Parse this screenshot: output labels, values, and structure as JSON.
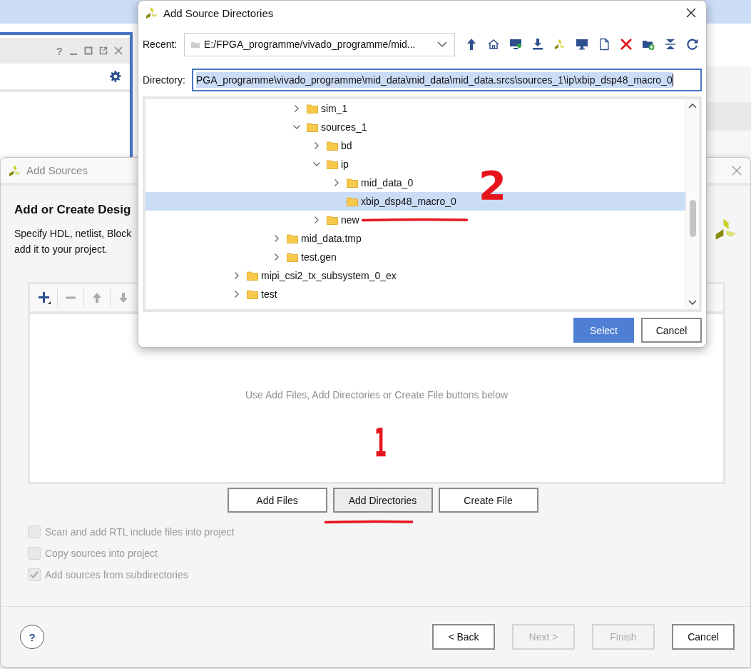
{
  "back_window": {
    "controls": [
      "?"
    ]
  },
  "add_sources": {
    "title": "Add Sources",
    "heading": "Add or Create Desig",
    "description": [
      "Specify HDL, netlist, Block",
      "add it to your project."
    ],
    "files_hint": "Use Add Files, Add Directories or Create File buttons below",
    "action_buttons": [
      {
        "label": "Add Files",
        "pressed": false
      },
      {
        "label": "Add Directories",
        "pressed": true
      },
      {
        "label": "Create File",
        "pressed": false
      }
    ],
    "options": [
      {
        "label": "Scan and add RTL include files into project",
        "checked": false,
        "disabled": true
      },
      {
        "label": "Copy sources into project",
        "checked": false,
        "disabled": true
      },
      {
        "label": "Add sources from subdirectories",
        "checked": true,
        "disabled": true
      }
    ],
    "help": "?",
    "nav_buttons": [
      {
        "label": "< Back",
        "disabled": false
      },
      {
        "label": "Next >",
        "disabled": true
      },
      {
        "label": "Finish",
        "disabled": true
      },
      {
        "label": "Cancel",
        "disabled": false
      }
    ]
  },
  "dialog": {
    "title": "Add Source Directories",
    "recent_label": "Recent:",
    "recent_value": "E:/FPGA_programme/vivado_programme/mid...",
    "directory_label": "Directory:",
    "directory_value": "PGA_programme\\vivado_programme\\mid_data\\mid_data\\mid_data.srcs\\sources_1\\ip\\xbip_dsp48_macro_0",
    "tree": [
      {
        "children": [
          {
            "children": [
              {
                "children": [
                  {
                    "label": "sim_1",
                    "expanded": false,
                    "selected": false
                  },
                  {
                    "label": "sources_1",
                    "expanded": true,
                    "selected": false,
                    "children": [
                      {
                        "label": "bd",
                        "expanded": false,
                        "selected": false
                      },
                      {
                        "label": "ip",
                        "expanded": true,
                        "selected": false,
                        "children": [
                          {
                            "label": "mid_data_0",
                            "expanded": false,
                            "selected": false
                          },
                          {
                            "label": "xbip_dsp48_macro_0",
                            "selected": true
                          }
                        ]
                      },
                      {
                        "label": "new",
                        "expanded": false,
                        "selected": false
                      }
                    ]
                  }
                ]
              },
              {
                "label": "mid_data.tmp",
                "expanded": false,
                "selected": false
              },
              {
                "label": "test.gen",
                "expanded": false,
                "selected": false
              }
            ]
          }
        ]
      },
      {
        "label": "mipi_csi2_tx_subsystem_0_ex",
        "expanded": false,
        "selected": false
      },
      {
        "label": "test",
        "expanded": false,
        "selected": false
      }
    ],
    "buttons": [
      {
        "label": "Select",
        "primary": true
      },
      {
        "label": "Cancel",
        "primary": false
      }
    ]
  },
  "annotations": [
    {
      "kind": "number",
      "text": "2"
    },
    {
      "kind": "underline"
    },
    {
      "kind": "number",
      "text": "1"
    },
    {
      "kind": "underline"
    }
  ]
}
